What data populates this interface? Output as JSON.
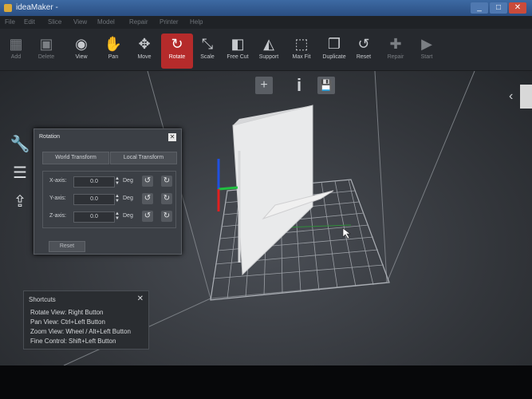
{
  "window": {
    "title": "ideaMaker -",
    "minimize": "_",
    "maximize": "□",
    "close": "✕"
  },
  "menu": [
    "File",
    "Edit",
    "Slice",
    "View",
    "Model",
    "Repair",
    "Printer",
    "Help"
  ],
  "toolbar": [
    {
      "label": "Add",
      "icon": "add-icon"
    },
    {
      "label": "Delete",
      "icon": "delete-icon"
    },
    {
      "label": "View",
      "icon": "eye-icon"
    },
    {
      "label": "Pan",
      "icon": "hand-icon"
    },
    {
      "label": "Move",
      "icon": "move-icon"
    },
    {
      "label": "Rotate",
      "icon": "rotate-icon"
    },
    {
      "label": "Scale",
      "icon": "scale-icon"
    },
    {
      "label": "Free Cut",
      "icon": "cut-icon"
    },
    {
      "label": "Support",
      "icon": "support-icon"
    },
    {
      "label": "Max Fit",
      "icon": "max-fit-icon"
    },
    {
      "label": "Duplicate",
      "icon": "duplicate-icon"
    },
    {
      "label": "Reset",
      "icon": "reset-icon"
    },
    {
      "label": "Repair",
      "icon": "repair-icon"
    },
    {
      "label": "Start",
      "icon": "start-icon"
    }
  ],
  "viewport_buttons": {
    "add": "+",
    "info": "i",
    "save": "💾"
  },
  "rotation_panel": {
    "title": "Rotation",
    "close": "✕",
    "tabs": [
      "World Transform",
      "Local Transform"
    ],
    "axes": [
      {
        "label": "X-axis:",
        "value": "0.0",
        "unit": "Deg"
      },
      {
        "label": "Y-axis:",
        "value": "0.0",
        "unit": "Deg"
      },
      {
        "label": "Z-axis:",
        "value": "0.0",
        "unit": "Deg"
      }
    ],
    "reset": "Reset"
  },
  "shortcuts": {
    "title": "Shortcuts",
    "close": "✕",
    "lines": [
      "Rotate View: Right Button",
      "Pan View: Ctrl+Left Button",
      "Zoom View: Wheel / Alt+Left Button",
      "Fine Control: Shift+Left Button"
    ]
  },
  "colors": {
    "accent_active": "#b52b2b",
    "axis_x": "#e02020",
    "axis_y": "#20c040",
    "axis_z": "#2050e0",
    "model": "#e8e9ea"
  }
}
